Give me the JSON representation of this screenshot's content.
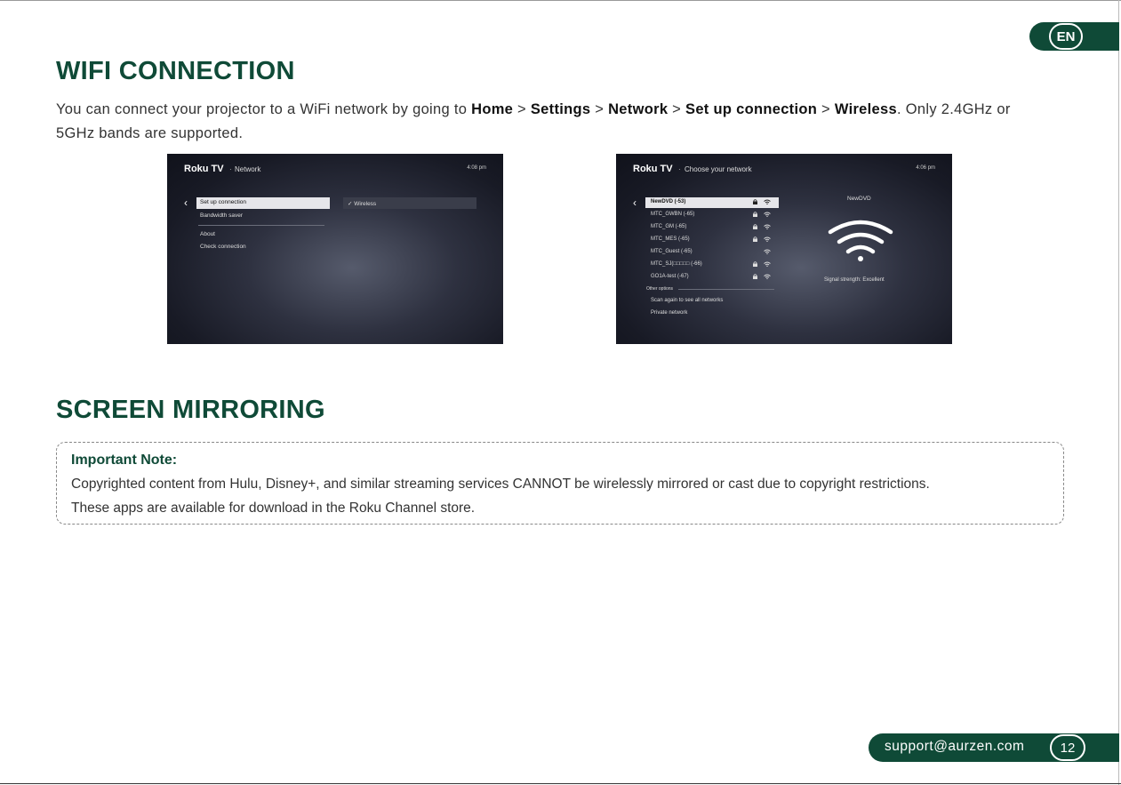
{
  "lang": "EN",
  "wifi": {
    "title": "WIFI CONNECTION",
    "intro_1": "You can connect your projector to a WiFi network by going to ",
    "path_home": "Home",
    "sep": " > ",
    "path_settings": "Settings",
    "path_network": "Network",
    "path_setup": "Set up connection",
    "path_wireless": "Wireless",
    "intro_2": ". Only 2.4GHz or",
    "intro_3": "5GHz bands are supported."
  },
  "screen1": {
    "logo": "Roku TV",
    "dot": "·",
    "title": "Network",
    "time": "4:08 pm",
    "menu": [
      "Set up connection",
      "Bandwidth saver",
      "About",
      "Check connection"
    ],
    "right_option": "Wireless"
  },
  "screen2": {
    "logo": "Roku TV",
    "dot": "·",
    "title": "Choose your network",
    "time": "4:06 pm",
    "networks": [
      {
        "name": "NewDVD  (-53)",
        "locked": true
      },
      {
        "name": "MTC_GWBN  (-65)",
        "locked": true
      },
      {
        "name": "MTC_GM  (-65)",
        "locked": true
      },
      {
        "name": "MTC_MES  (-65)",
        "locked": true
      },
      {
        "name": "MTC_Guest  (-65)",
        "locked": false
      },
      {
        "name": "MTC_SJ(□□□□□  (-66)",
        "locked": true
      },
      {
        "name": "GO1A-test  (-67)",
        "locked": true
      }
    ],
    "other_options": "Other options",
    "scan_again": "Scan again to see all networks",
    "private_network": "Private network",
    "selected_name": "NewDVD",
    "signal_strength": "Signal strength: Excellent"
  },
  "mirroring": {
    "title": "SCREEN MIRRORING",
    "note_title": "Important Note:",
    "note_line1": "Copyrighted content from Hulu, Disney+, and similar streaming services CANNOT be wirelessly mirrored or cast due to copyright restrictions.",
    "note_line2": "These apps are available for download in the Roku Channel store."
  },
  "footer": {
    "email": "support@aurzen.com",
    "page": "12"
  },
  "colors": {
    "brand_green": "#0f4a37"
  }
}
